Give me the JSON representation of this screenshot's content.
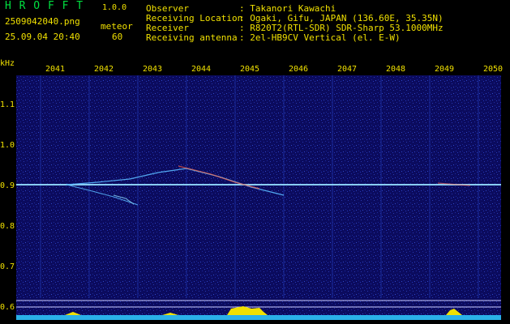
{
  "header": {
    "app": "H R O F F T",
    "version": "1.0.0",
    "filename": "2509042040.png",
    "datetime": "25.09.04 20:40",
    "meteor_label": "meteor",
    "meteor_count": "60",
    "fields": [
      {
        "label": "Observer",
        "value": ": Takanori Kawachi"
      },
      {
        "label": "Receiving Location",
        "value": ": Ogaki, Gifu, JAPAN (136.60E, 35.35N)"
      },
      {
        "label": "Receiver",
        "value": ": R820T2(RTL-SDR) SDR-Sharp 53.1000MHz"
      },
      {
        "label": "Receiving antenna",
        "value": ": 2el-HB9CV Vertical (el. E-W)"
      }
    ]
  },
  "axis": {
    "y_unit": "kHz",
    "y_ticks": [
      "1.1",
      "1.0",
      "0.9",
      "0.8",
      "0.7",
      "0.6"
    ],
    "x_ticks": [
      "2041",
      "2042",
      "2043",
      "2044",
      "2045",
      "2046",
      "2047",
      "2048",
      "2049",
      "2050"
    ]
  },
  "colors": {
    "background": "#0a0a5a",
    "text": "#f0e000",
    "logo": "#00e040",
    "signal": "#a0e8ff",
    "baseline": "#ffff00"
  }
}
